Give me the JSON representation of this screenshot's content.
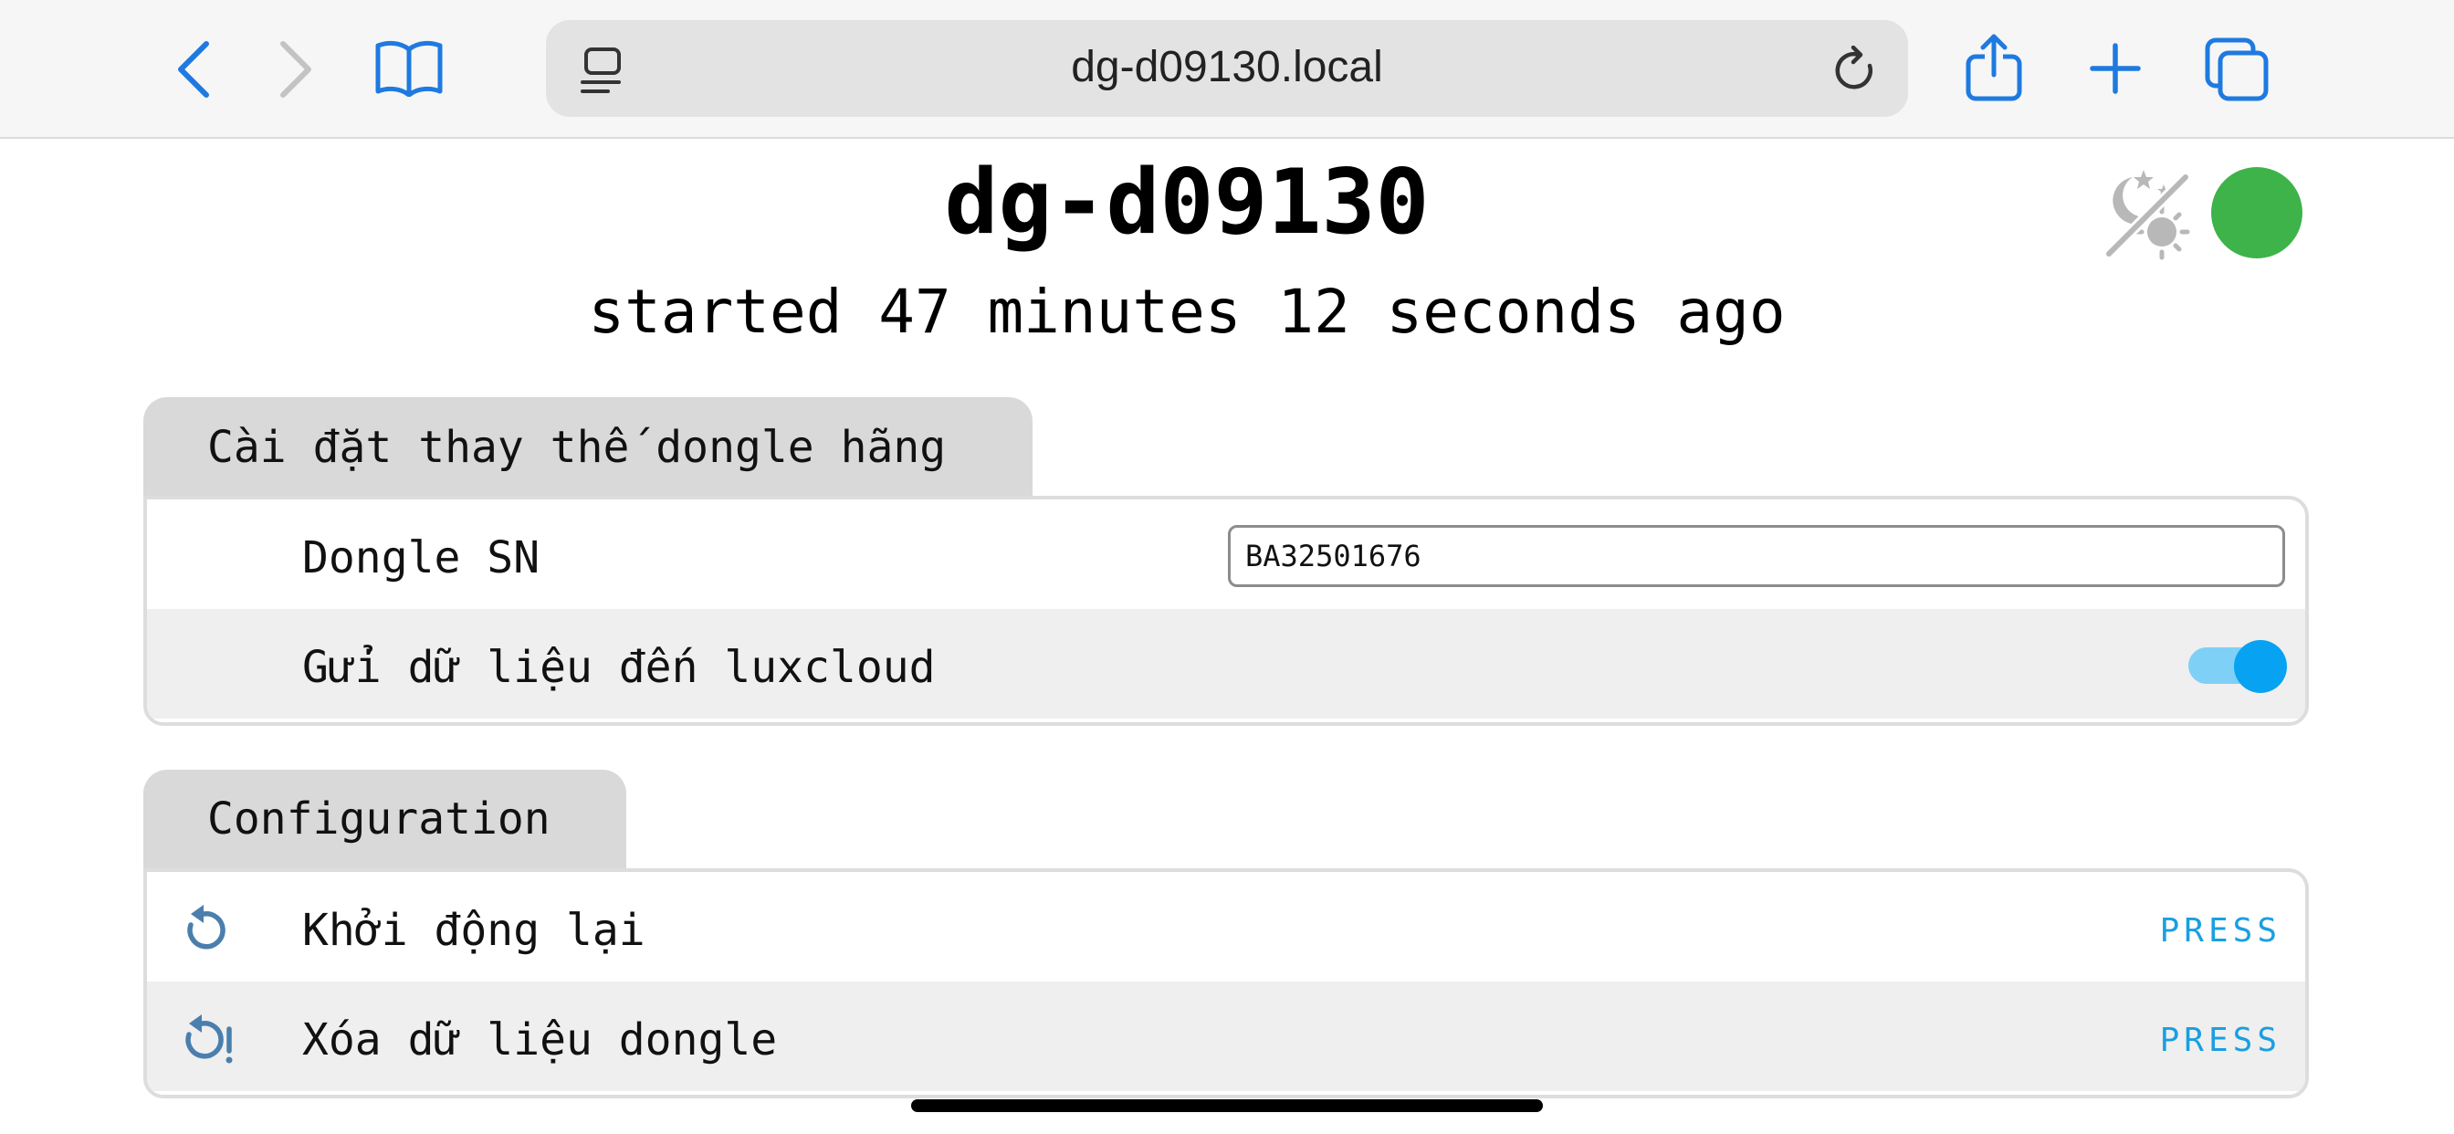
{
  "browser": {
    "address": "dg-d09130.local"
  },
  "header": {
    "title": "dg-d09130",
    "subtitle": "started 47 minutes 12 seconds ago",
    "status_color": "#3db34a"
  },
  "panels": [
    {
      "tab_label": "Cài đặt thay thế dongle hãng",
      "rows": [
        {
          "label": "Dongle SN",
          "input_value": "BA32501676"
        },
        {
          "label": "Gửi dữ liệu đến luxcloud",
          "toggle_on": true
        }
      ]
    },
    {
      "tab_label": "Configuration",
      "rows": [
        {
          "label": "Khởi động lại",
          "icon": "restart-icon",
          "action": "PRESS"
        },
        {
          "label": "Xóa dữ liệu dongle",
          "icon": "restart-alert-icon",
          "action": "PRESS"
        }
      ]
    }
  ],
  "colors": {
    "accent": "#1a9fe0",
    "toggle_track": "#7fd0f6",
    "toggle_knob": "#08a2f2",
    "toolbar_icon": "#1f7ae0"
  }
}
